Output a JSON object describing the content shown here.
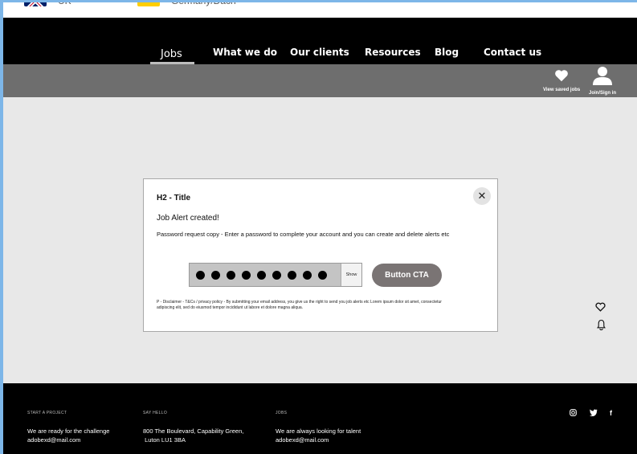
{
  "languages": [
    {
      "label": "UK",
      "flag": "uk-flag-icon"
    },
    {
      "label": "Germany/Dach",
      "flag": "germany-flag-icon"
    }
  ],
  "nav": {
    "items": [
      "Jobs",
      "What we do",
      "Our clients",
      "Resources",
      "Blog",
      "Contact us"
    ],
    "active": "Jobs"
  },
  "subbar": {
    "saved_jobs_label": "View saved jobs",
    "join_label": "Join/Sign in"
  },
  "modal": {
    "title": "H2 - Title",
    "subtitle": "Job Alert created!",
    "copy": "Password request copy - Enter a password to complete your account and you can create and delete alerts etc",
    "password_mask_count": 9,
    "show_label": "Show",
    "cta_label": "Button CTA",
    "close_icon": "close-icon",
    "disclaimer": "P - Disclaimer - T&Cs / privacy policy - By submitting your email address, you give us the right to send you job alerts etc Lorem ipsum dolor sit amet, consectetur adipiscing elit, sed do eiusmod tempor incididunt ut labore et dolore magna aliqua."
  },
  "footer": {
    "columns": [
      {
        "heading": "START A PROJECT",
        "lines": [
          "We are ready for the challenge",
          "adobexd@mail.com"
        ]
      },
      {
        "heading": "SAY HELLO",
        "lines": [
          "800 The Boulevard, Capability Green,",
          " Luton LU1 3BA"
        ]
      },
      {
        "heading": "JOBS",
        "lines": [
          "We are always looking for talent",
          "adobexd@mail.com"
        ]
      }
    ],
    "social": [
      "instagram-icon",
      "twitter-icon",
      "facebook-icon"
    ]
  },
  "colors": {
    "nav_bg": "#000000",
    "subbar_bg": "#6e6e6e",
    "page_bg": "#e8e8e8",
    "cta_bg": "#7a7474"
  }
}
